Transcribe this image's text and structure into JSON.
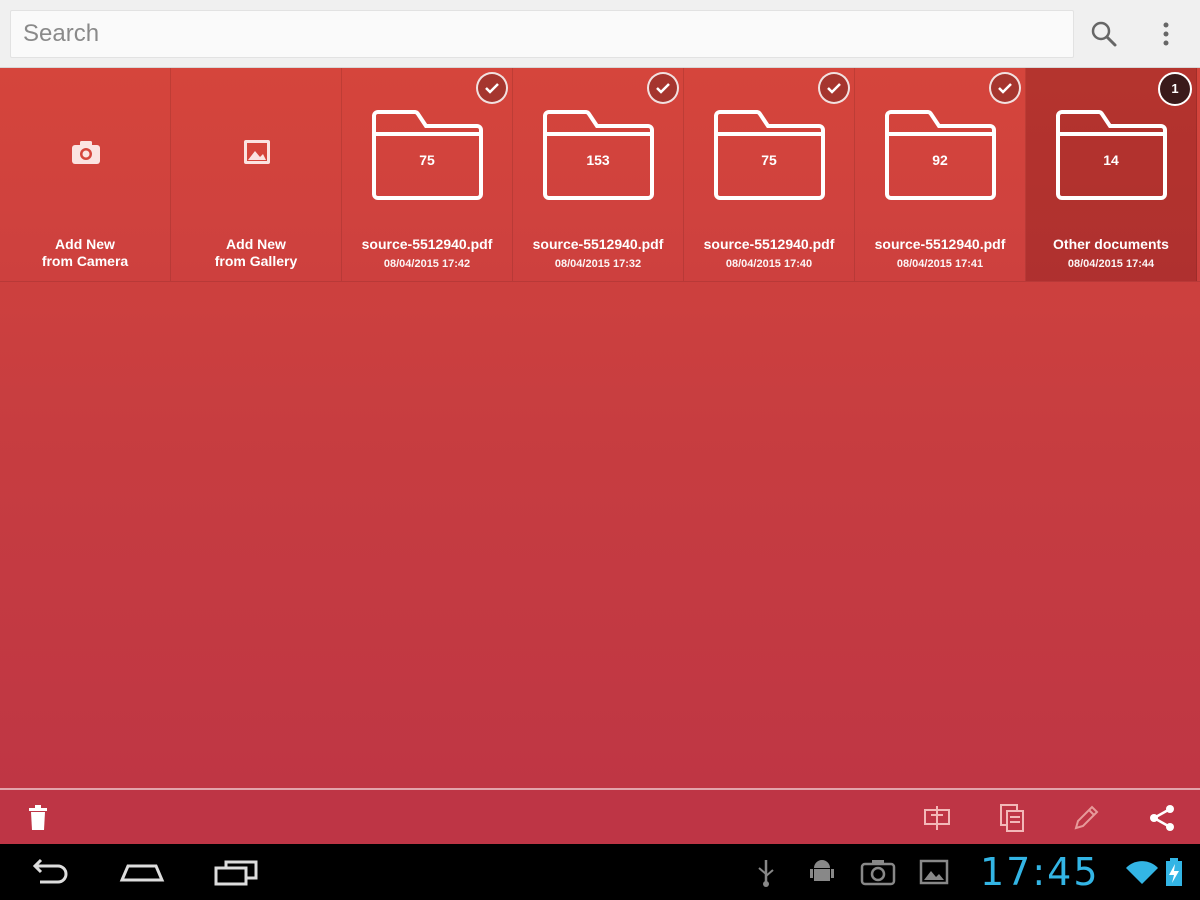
{
  "search": {
    "placeholder": "Search"
  },
  "actions": [
    {
      "label": "Add New\nfrom Camera",
      "icon": "camera-icon"
    },
    {
      "label": "Add New\nfrom Gallery",
      "icon": "gallery-icon"
    }
  ],
  "folders": [
    {
      "count": "75",
      "name": "source-5512940.pdf",
      "date": "08/04/2015 17:42",
      "state": "checked"
    },
    {
      "count": "153",
      "name": "source-5512940.pdf",
      "date": "08/04/2015 17:32",
      "state": "checked"
    },
    {
      "count": "75",
      "name": "source-5512940.pdf",
      "date": "08/04/2015 17:40",
      "state": "checked"
    },
    {
      "count": "92",
      "name": "source-5512940.pdf",
      "date": "08/04/2015 17:41",
      "state": "checked"
    },
    {
      "count": "14",
      "name": "Other documents",
      "date": "08/04/2015 17:44",
      "state": "selected",
      "badge": "1"
    }
  ],
  "actionbar_icons": [
    "trash-icon",
    "ocr-icon",
    "document-copy-icon",
    "pencil-icon",
    "share-icon"
  ],
  "statusbar": {
    "time": "17:45"
  },
  "colors": {
    "accent": "#33b5e5",
    "primary": "#d5453c",
    "primary_dark": "#be3545"
  }
}
